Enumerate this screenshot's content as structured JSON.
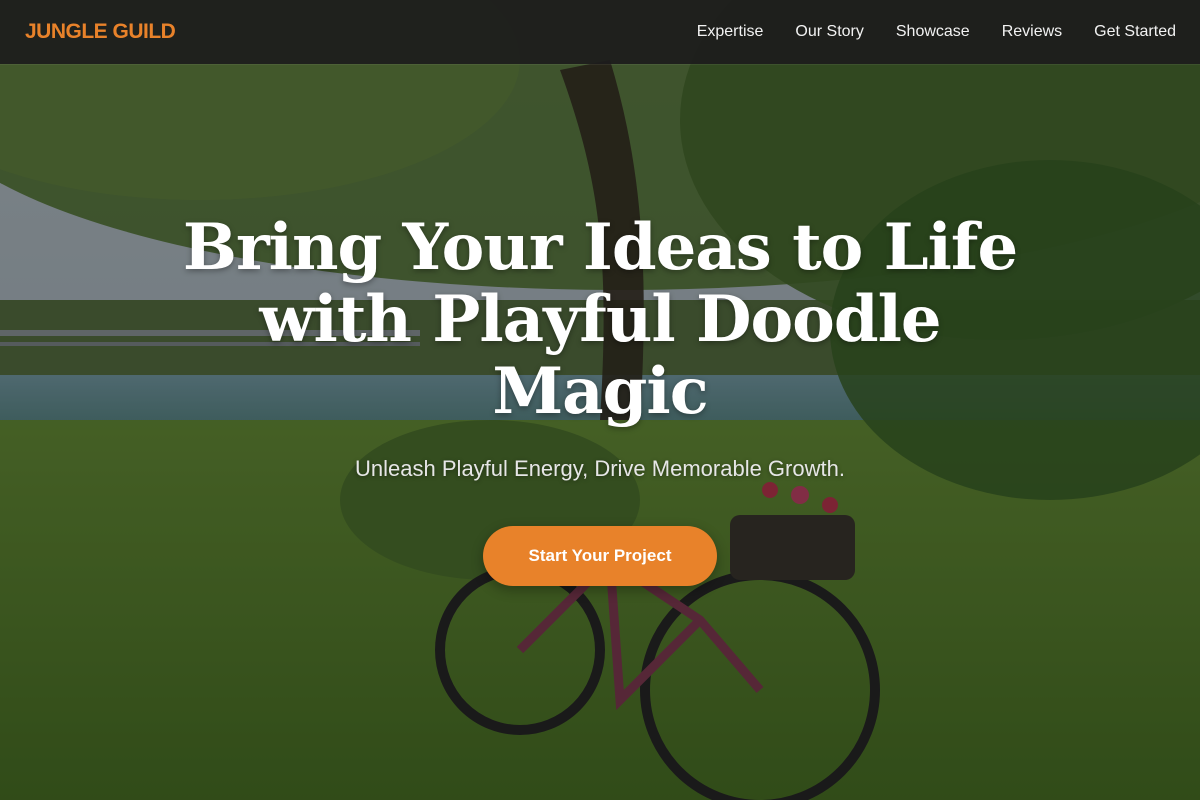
{
  "brand": {
    "name": "JUNGLE GUILD",
    "color": "#e8822a"
  },
  "nav": {
    "items": [
      {
        "label": "Expertise"
      },
      {
        "label": "Our Story"
      },
      {
        "label": "Showcase"
      },
      {
        "label": "Reviews"
      },
      {
        "label": "Get Started"
      }
    ]
  },
  "hero": {
    "title": "Bring Your Ideas to Life with Playful Doodle Magic",
    "subtitle": "Unleash Playful Energy, Drive Memorable Growth.",
    "cta_label": "Start Your Project",
    "cta_color": "#e8822a",
    "background_image": "riverside-bicycle-photo"
  }
}
